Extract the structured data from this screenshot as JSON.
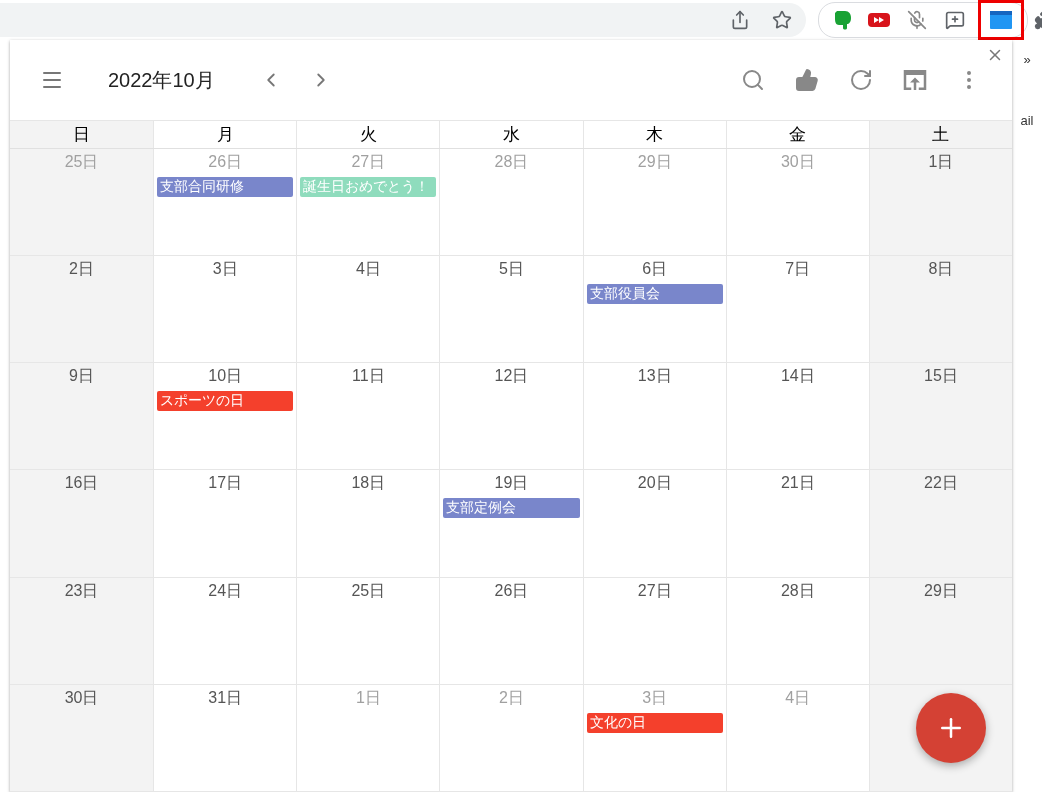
{
  "browser": {
    "side_texts": [
      "»",
      "ail"
    ]
  },
  "header": {
    "title": "2022年10月"
  },
  "weekdays": [
    {
      "label": "日",
      "weekend": true
    },
    {
      "label": "月",
      "weekend": false
    },
    {
      "label": "火",
      "weekend": false
    },
    {
      "label": "水",
      "weekend": false
    },
    {
      "label": "木",
      "weekend": false
    },
    {
      "label": "金",
      "weekend": false
    },
    {
      "label": "土",
      "weekend": true
    }
  ],
  "weeks": [
    [
      {
        "label": "25日",
        "muted": true
      },
      {
        "label": "26日",
        "muted": true,
        "events": [
          {
            "title": "支部合同研修",
            "color": "#7986cb"
          }
        ]
      },
      {
        "label": "27日",
        "muted": true,
        "events": [
          {
            "title": "誕生日おめでとう！",
            "color": "#8fdcbd"
          }
        ]
      },
      {
        "label": "28日",
        "muted": true
      },
      {
        "label": "29日",
        "muted": true
      },
      {
        "label": "30日",
        "muted": true
      },
      {
        "label": "1日",
        "muted": false
      }
    ],
    [
      {
        "label": "2日",
        "muted": false
      },
      {
        "label": "3日",
        "muted": false
      },
      {
        "label": "4日",
        "muted": false
      },
      {
        "label": "5日",
        "muted": false
      },
      {
        "label": "6日",
        "muted": false,
        "events": [
          {
            "title": "支部役員会",
            "color": "#7986cb"
          }
        ]
      },
      {
        "label": "7日",
        "muted": false
      },
      {
        "label": "8日",
        "muted": false
      }
    ],
    [
      {
        "label": "9日",
        "muted": false
      },
      {
        "label": "10日",
        "muted": false,
        "events": [
          {
            "title": "スポーツの日",
            "color": "#f4402c"
          }
        ]
      },
      {
        "label": "11日",
        "muted": false
      },
      {
        "label": "12日",
        "muted": false
      },
      {
        "label": "13日",
        "muted": false
      },
      {
        "label": "14日",
        "muted": false
      },
      {
        "label": "15日",
        "muted": false
      }
    ],
    [
      {
        "label": "16日",
        "muted": false
      },
      {
        "label": "17日",
        "muted": false
      },
      {
        "label": "18日",
        "muted": false
      },
      {
        "label": "19日",
        "muted": false,
        "events": [
          {
            "title": "支部定例会",
            "color": "#7986cb"
          }
        ]
      },
      {
        "label": "20日",
        "muted": false
      },
      {
        "label": "21日",
        "muted": false
      },
      {
        "label": "22日",
        "muted": false
      }
    ],
    [
      {
        "label": "23日",
        "muted": false
      },
      {
        "label": "24日",
        "muted": false
      },
      {
        "label": "25日",
        "muted": false
      },
      {
        "label": "26日",
        "muted": false
      },
      {
        "label": "27日",
        "muted": false
      },
      {
        "label": "28日",
        "muted": false
      },
      {
        "label": "29日",
        "muted": false
      }
    ],
    [
      {
        "label": "30日",
        "muted": false
      },
      {
        "label": "31日",
        "muted": false
      },
      {
        "label": "1日",
        "muted": true
      },
      {
        "label": "2日",
        "muted": true
      },
      {
        "label": "3日",
        "muted": true,
        "events": [
          {
            "title": "文化の日",
            "color": "#f4402c"
          }
        ]
      },
      {
        "label": "4日",
        "muted": true
      }
    ]
  ]
}
